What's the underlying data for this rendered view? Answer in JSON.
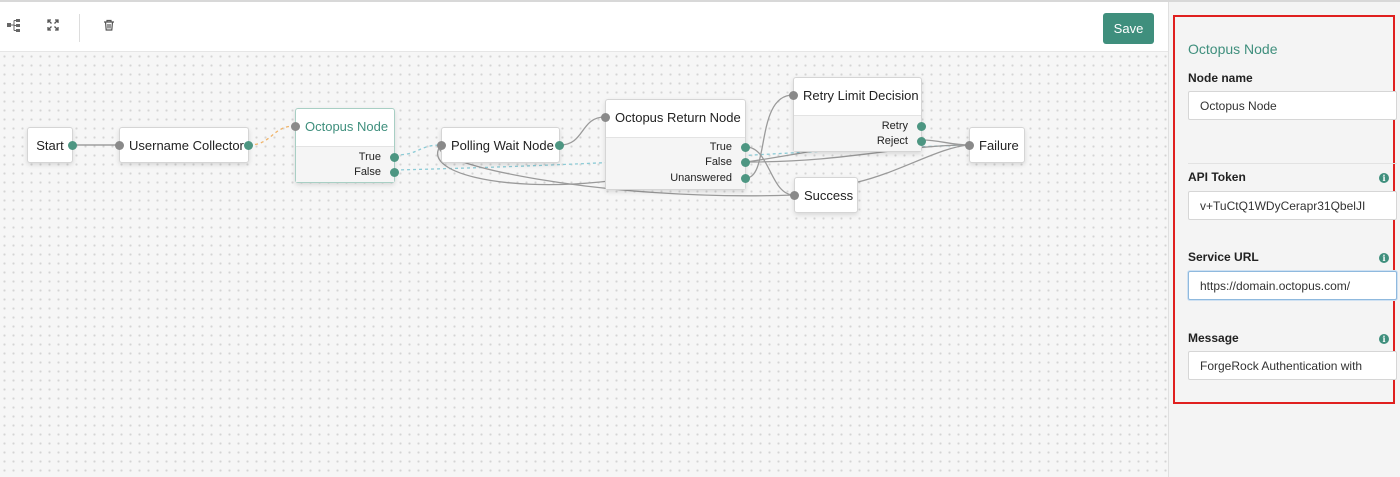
{
  "toolbar": {
    "icons": [
      "tree-layout-icon",
      "fullscreen-icon",
      "trash-icon"
    ],
    "save_label": "Save"
  },
  "nodes": {
    "start": {
      "label": "Start"
    },
    "username_collector": {
      "label": "Username Collector"
    },
    "octopus_node": {
      "label": "Octopus Node",
      "outcomes": [
        "True",
        "False"
      ]
    },
    "polling_wait": {
      "label": "Polling Wait Node"
    },
    "octopus_return": {
      "label": "Octopus Return Node",
      "outcomes": [
        "True",
        "False",
        "Unanswered"
      ]
    },
    "retry_limit": {
      "label": "Retry Limit Decision",
      "outcomes": [
        "Retry",
        "Reject"
      ]
    },
    "success": {
      "label": "Success"
    },
    "failure": {
      "label": "Failure"
    }
  },
  "panel": {
    "title": "Octopus Node",
    "fields": [
      {
        "label": "Node name",
        "value": "Octopus Node",
        "info": false
      },
      {
        "label": "API Token",
        "value": "v+TuCtQ1WDyCerapr31QbelJI",
        "info": true
      },
      {
        "label": "Service URL",
        "value": "https://domain.octopus.com/",
        "info": true
      },
      {
        "label": "Message",
        "value": "ForgeRock Authentication with",
        "info": true
      }
    ]
  },
  "colors": {
    "accent": "#3f8f7d",
    "highlight_border": "#e0201f",
    "link_grey": "#9a9a9a",
    "link_blue_dashed": "#8ccbd6",
    "link_orange_dashed": "#f0b46a"
  }
}
